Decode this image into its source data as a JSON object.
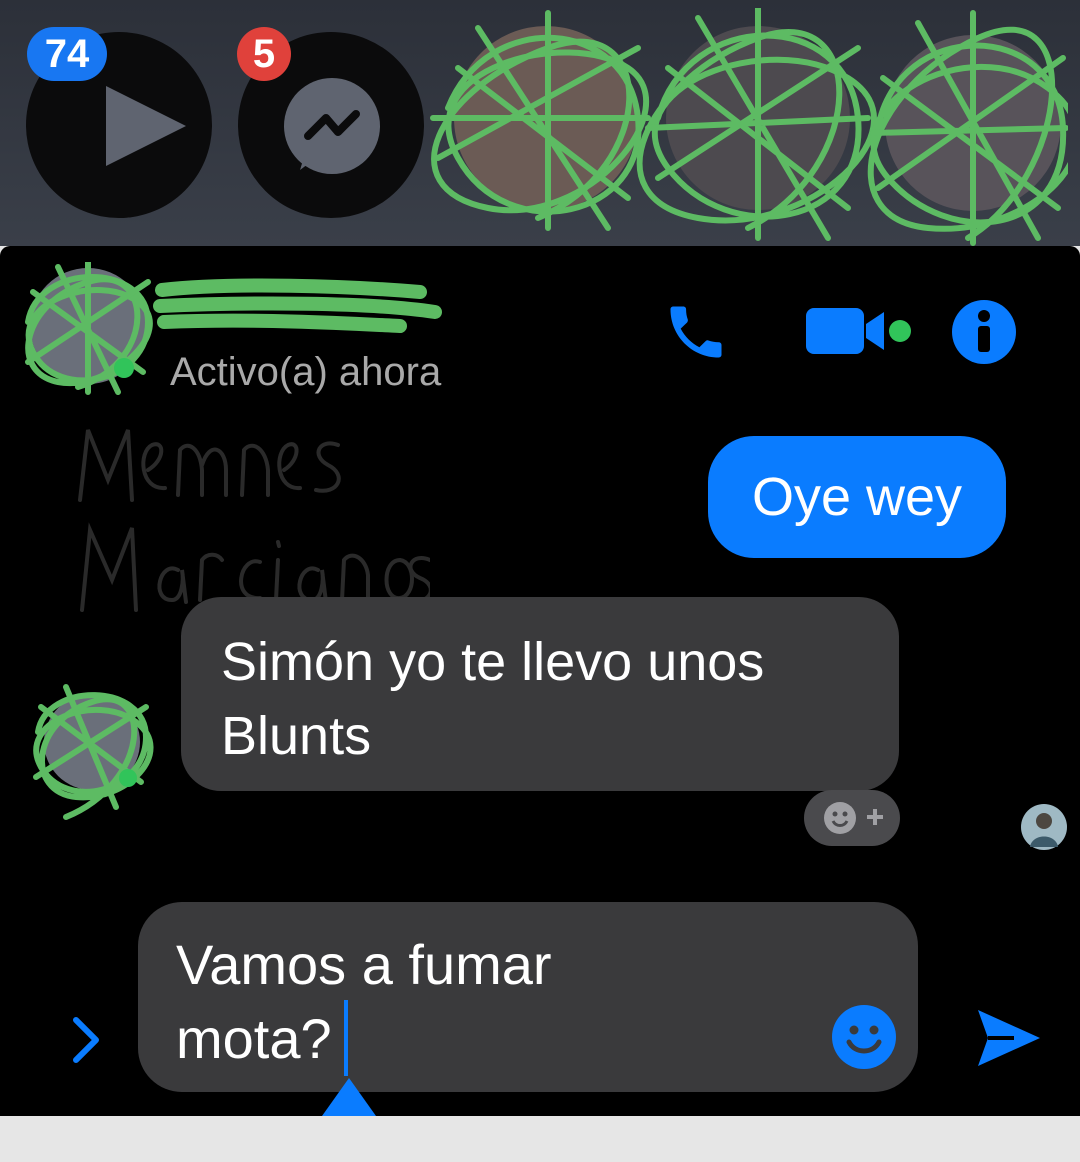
{
  "chat_heads": {
    "video_badge": "74",
    "messenger_badge": "5",
    "video_icon": "play-icon",
    "messenger_icon": "messenger-icon"
  },
  "conversation": {
    "status": "Activo(a) ahora",
    "call_icon": "phone-icon",
    "video_call_icon": "video-camera-icon",
    "info_icon": "info-icon"
  },
  "messages": {
    "outgoing_1": "Oye wey",
    "incoming_1": "Simón yo te llevo unos Blunts"
  },
  "composer": {
    "text": "Vamos a fumar\nmota?",
    "expand_icon": "chevron-right-icon",
    "emoji_icon": "emoji-icon",
    "send_icon": "send-icon"
  },
  "colors": {
    "accent": "#0a7cff",
    "badge_blue": "#1877f2",
    "badge_red": "#e0413b",
    "active_green": "#31c45a",
    "scribble": "#5dbb63"
  }
}
